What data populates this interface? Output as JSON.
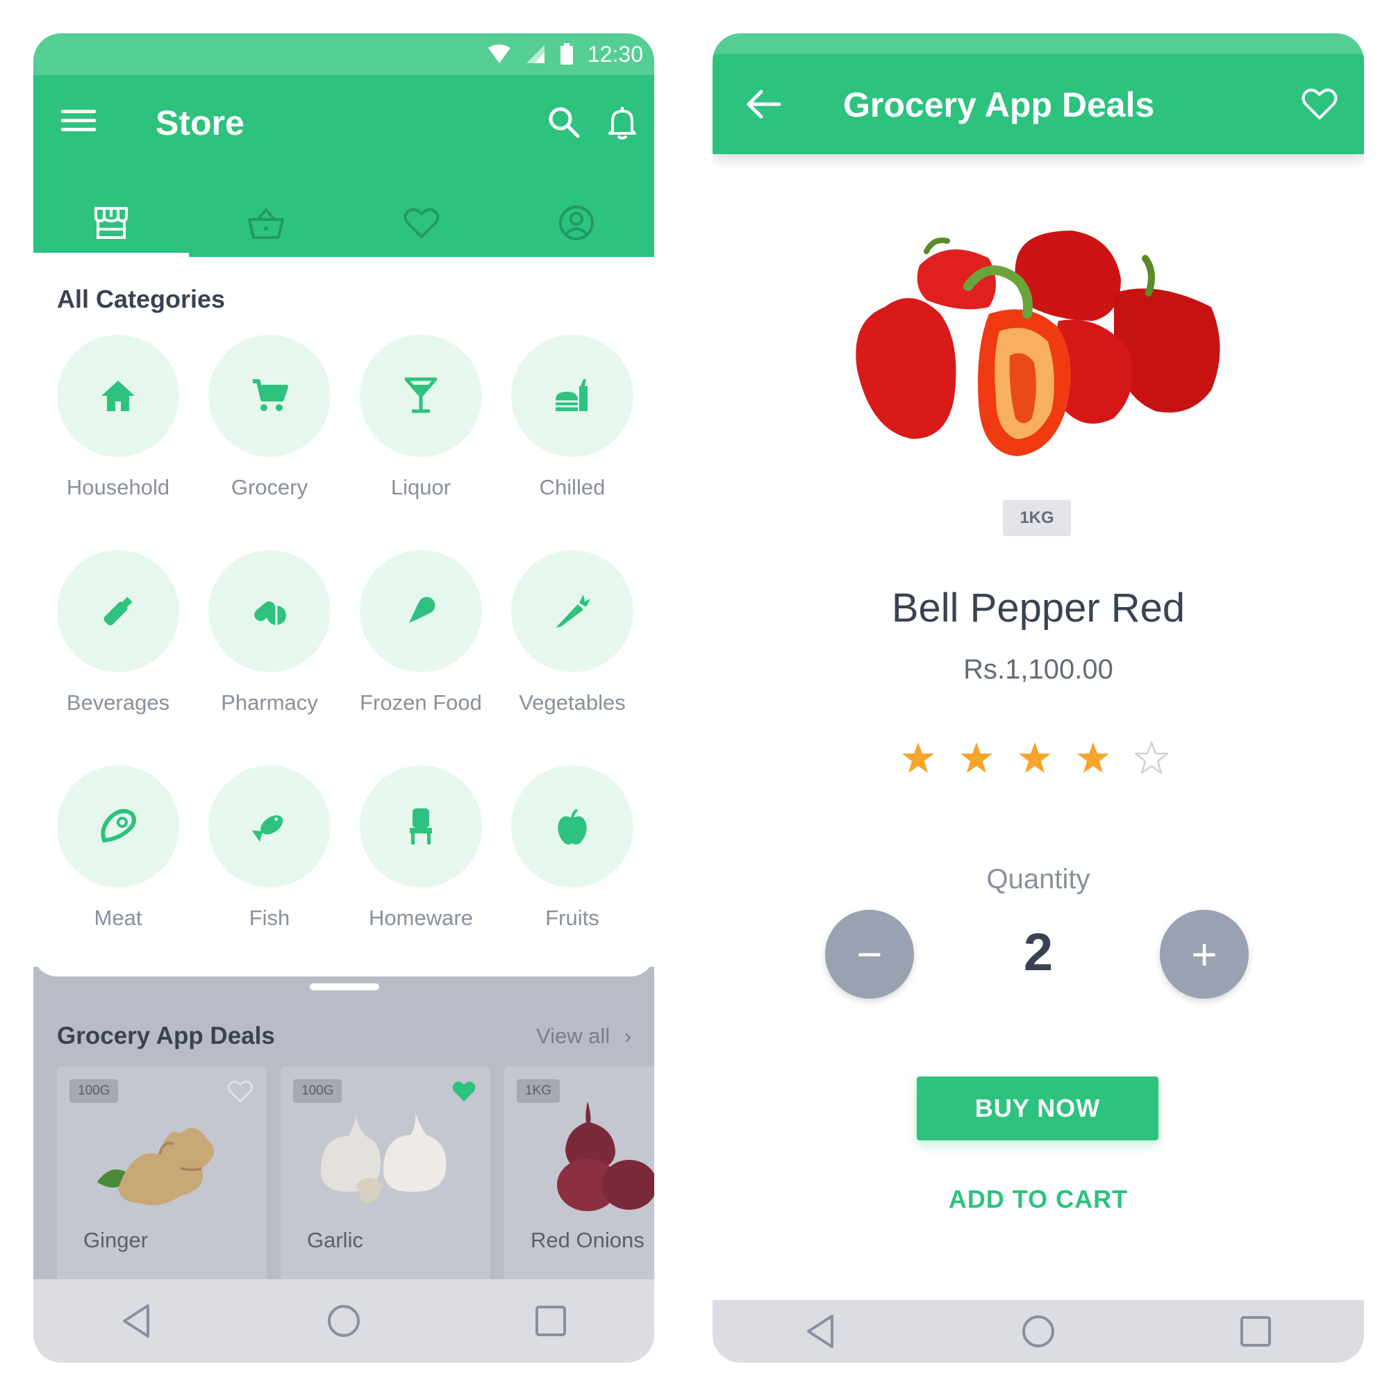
{
  "left_screen": {
    "status": {
      "time": "12:30"
    },
    "appbar": {
      "title": "Store"
    },
    "tabs": [
      {
        "id": "store",
        "icon": "storefront-icon",
        "active": true
      },
      {
        "id": "basket",
        "icon": "basket-icon",
        "active": false
      },
      {
        "id": "wishlist",
        "icon": "heart-icon",
        "active": false
      },
      {
        "id": "account",
        "icon": "account-icon",
        "active": false
      }
    ],
    "categories_title": "All Categories",
    "categories": [
      {
        "label": "Household",
        "icon": "home-icon"
      },
      {
        "label": "Grocery",
        "icon": "cart-icon"
      },
      {
        "label": "Liquor",
        "icon": "cocktail-icon"
      },
      {
        "label": "Chilled",
        "icon": "chilled-icon"
      },
      {
        "label": "Beverages",
        "icon": "bottle-icon"
      },
      {
        "label": "Pharmacy",
        "icon": "pills-icon"
      },
      {
        "label": "Frozen Food",
        "icon": "ice-cream-icon"
      },
      {
        "label": "Vegetables",
        "icon": "carrot-icon"
      },
      {
        "label": "Meat",
        "icon": "steak-icon"
      },
      {
        "label": "Fish",
        "icon": "fish-icon"
      },
      {
        "label": "Homeware",
        "icon": "chair-icon"
      },
      {
        "label": "Fruits",
        "icon": "apple-icon"
      }
    ],
    "deals": {
      "title": "Grocery App Deals",
      "view_all": "View all",
      "items": [
        {
          "name": "Ginger",
          "weight": "100G",
          "favorite": false
        },
        {
          "name": "Garlic",
          "weight": "100G",
          "favorite": true
        },
        {
          "name": "Red Onions",
          "weight": "1KG",
          "favorite": false
        }
      ]
    }
  },
  "right_screen": {
    "appbar": {
      "title": "Grocery App Deals"
    },
    "product": {
      "weight": "1KG",
      "name": "Bell Pepper Red",
      "price": "Rs.1,100.00",
      "rating": 4,
      "rating_max": 5
    },
    "quantity": {
      "label": "Quantity",
      "value": "2",
      "minus": "−",
      "plus": "+"
    },
    "actions": {
      "buy_now": "BUY NOW",
      "add_to_cart": "ADD TO CART"
    }
  },
  "colors": {
    "primary": "#2dc27e",
    "status_bar": "#55ce94",
    "category_bg": "#e6f8ee",
    "star": "#f7a42a"
  }
}
